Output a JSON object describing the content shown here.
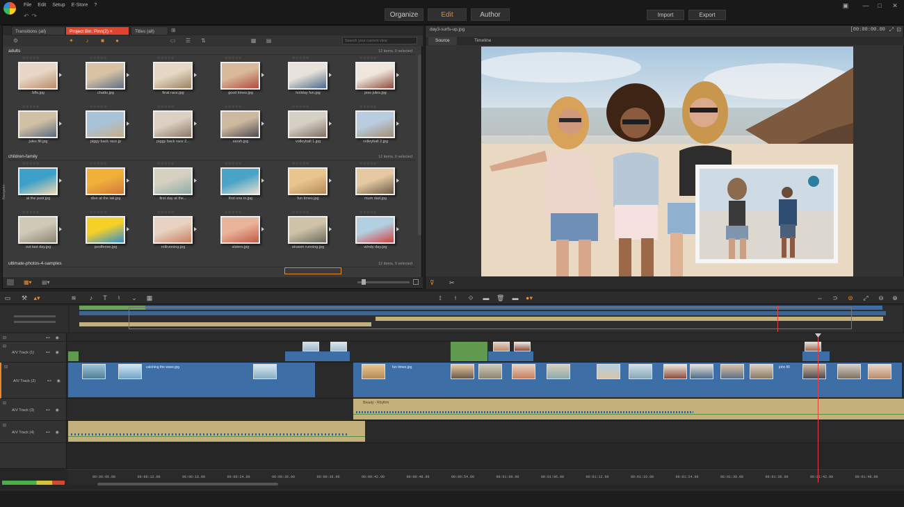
{
  "menu": [
    "File",
    "Edit",
    "Setup",
    "E-Store",
    "?"
  ],
  "modes": [
    {
      "label": "Organize",
      "active": false
    },
    {
      "label": "Edit",
      "active": true
    },
    {
      "label": "Author",
      "active": false
    }
  ],
  "top_buttons": {
    "import": "Import",
    "export": "Export"
  },
  "library": {
    "tabs": [
      {
        "label": "Transitions (all)",
        "active": false
      },
      {
        "label": "Project Bin: Pinn(2) ×",
        "active": true
      },
      {
        "label": "Titles (all)",
        "active": false
      }
    ],
    "search_placeholder": "Search your current view",
    "navigator_label": "Navigator",
    "sections": [
      {
        "title": "adults",
        "count": "12 items, 0 selected",
        "items": [
          {
            "name": "bffs.jpg",
            "c1": "#e8d6c6",
            "c2": "#b98b6c"
          },
          {
            "name": "chatto.jpg",
            "c1": "#d9c2a4",
            "c2": "#5f6f86"
          },
          {
            "name": "final race.jpg",
            "c1": "#e6d8c4",
            "c2": "#9a8262"
          },
          {
            "name": "good times.jpg",
            "c1": "#d8b99a",
            "c2": "#b34a3d"
          },
          {
            "name": "holiday fun.jpg",
            "c1": "#e7e2da",
            "c2": "#4b6a88"
          },
          {
            "name": "jess jules.jpg",
            "c1": "#efe6dc",
            "c2": "#8a4d3d"
          },
          {
            "name": "jules fill.jpg",
            "c1": "#d2c0a5",
            "c2": "#5a6b7c"
          },
          {
            "name": "piggy back race.jp",
            "c1": "#a8c3d8",
            "c2": "#c9ad88"
          },
          {
            "name": "piggy back race 2...",
            "c1": "#dcd0c2",
            "c2": "#8b7965"
          },
          {
            "name": "sarah.jpg",
            "c1": "#cdb8a0",
            "c2": "#4e4a50"
          },
          {
            "name": "volleyball 1.jpg",
            "c1": "#d6cfc6",
            "c2": "#7e7063"
          },
          {
            "name": "volleyball 2.jpg",
            "c1": "#b9cde0",
            "c2": "#a38d71"
          }
        ]
      },
      {
        "title": "children-family",
        "count": "12 items, 0 selected",
        "items": [
          {
            "name": "at the pool.jpg",
            "c1": "#3ca0c8",
            "c2": "#f0d7b0"
          },
          {
            "name": "dive at the lak.jpg",
            "c1": "#f0b03a",
            "c2": "#d0783c"
          },
          {
            "name": "first day at the...",
            "c1": "#d5d0c0",
            "c2": "#8faaa8"
          },
          {
            "name": "first one in.jpg",
            "c1": "#4aa4c8",
            "c2": "#e8e0d0"
          },
          {
            "name": "fun times.jpg",
            "c1": "#e9c58e",
            "c2": "#b58a5a"
          },
          {
            "name": "mum dad.jpg",
            "c1": "#e6c9a0",
            "c2": "#6c5a4a"
          },
          {
            "name": "out last day.jpg",
            "c1": "#cfcab8",
            "c2": "#8b8470"
          },
          {
            "name": "poolfense.jpg",
            "c1": "#f4d028",
            "c2": "#2f8fd0"
          },
          {
            "name": "rollrunning.jpg",
            "c1": "#e8d2c2",
            "c2": "#c6805e"
          },
          {
            "name": "sisters.jpg",
            "c1": "#e9b49a",
            "c2": "#c25a44"
          },
          {
            "name": "strawm running.jpg",
            "c1": "#cfc4aa",
            "c2": "#6a6a5a"
          },
          {
            "name": "windy day.jpg",
            "c1": "#b2d0e2",
            "c2": "#d34040"
          }
        ]
      },
      {
        "title": "ultimate-photos-4-samples",
        "count": "12 items, 0 selected",
        "items": []
      }
    ]
  },
  "player": {
    "title": "day3-surfs-up.jpg",
    "timecode": "[00:00:00.00",
    "tabs": [
      {
        "label": "Source",
        "active": true
      },
      {
        "label": "Timeline",
        "active": false
      }
    ]
  },
  "timeline": {
    "tracks": [
      {
        "name": "A/V Track (1)"
      },
      {
        "name": "A/V Track (2)"
      },
      {
        "name": "A/V Track (3)"
      },
      {
        "name": "A/V Track (4)"
      }
    ],
    "clip_labels": {
      "catching": "catching the wave.jpg",
      "fun_times": "fun times.jpg",
      "john_fun": "john fill",
      "audio": "Beauty - Rhythm"
    },
    "ruler": [
      "00:00:06.00",
      "00:00:12.00",
      "00:00:18.00",
      "00:00:24.00",
      "00:00:30.00",
      "00:00:36.00",
      "00:00:42.00",
      "00:00:48.00",
      "00:00:54.00",
      "00:01:00.00",
      "00:01:06.00",
      "00:01:12.00",
      "00:01:18.00",
      "00:01:24.00",
      "00:01:30.00",
      "00:01:36.00",
      "00:01:42.00",
      "00:01:48.00"
    ]
  },
  "colors": {
    "accent": "#f08a2a",
    "active_tab": "#e0442c",
    "video_clip": "#3d6ea5",
    "audio_clip": "#c4b07a",
    "playhead": "#e34040"
  }
}
